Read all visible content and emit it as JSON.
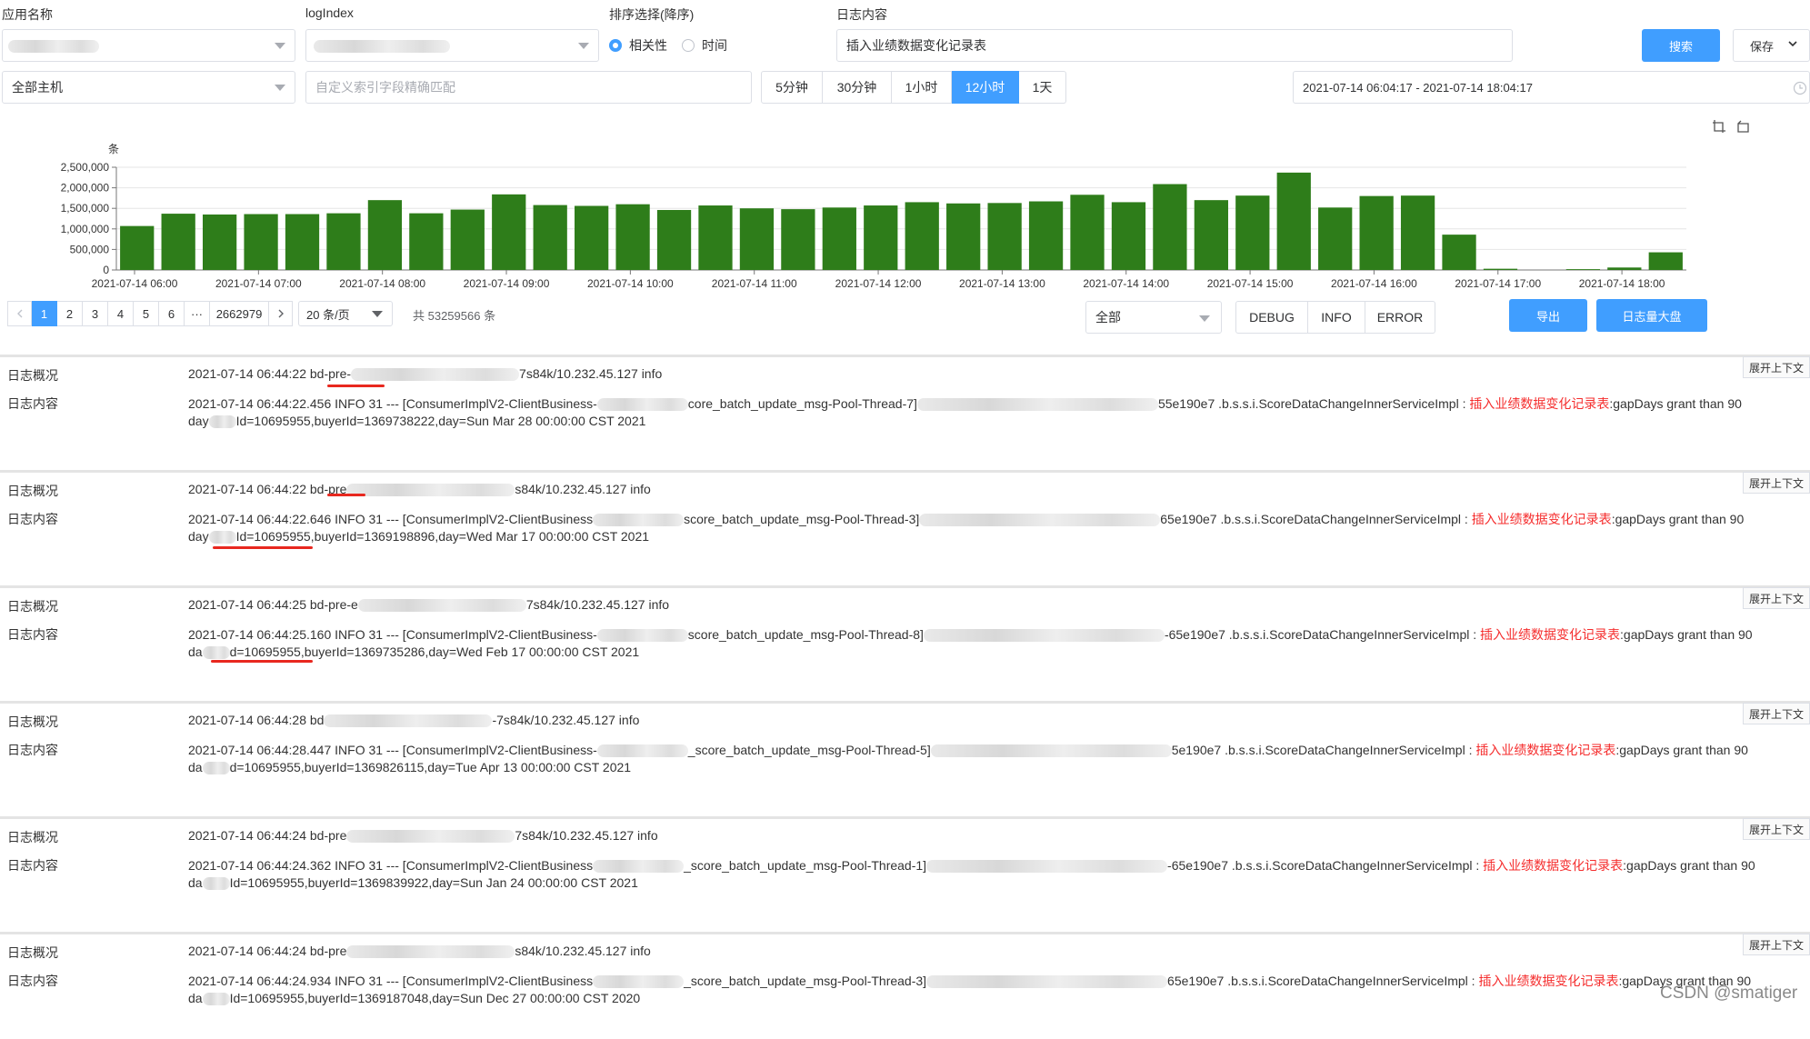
{
  "filters": {
    "app_label": "应用名称",
    "logindex_label": "logIndex",
    "sort_label": "排序选择(降序)",
    "sort_options": [
      "相关性",
      "时间"
    ],
    "sort_selected": "相关性",
    "content_label": "日志内容",
    "content_value": "插入业绩数据变化记录表",
    "search_button": "搜索",
    "save_button": "保存",
    "host_value": "全部主机",
    "custom_index_placeholder": "自定义索引字段精确匹配",
    "time_ranges": [
      "5分钟",
      "30分钟",
      "1小时",
      "12小时",
      "1天"
    ],
    "time_range_active": "12小时",
    "date_range": "2021-07-14 06:04:17 - 2021-07-14 18:04:17"
  },
  "chart_data": {
    "type": "bar",
    "ylabel": "条",
    "ylim": [
      0,
      2500000
    ],
    "yticks": [
      "2,500,000",
      "2,000,000",
      "1,500,000",
      "1,000,000",
      "500,000",
      "0"
    ],
    "xtick_labels": [
      "2021-07-14 06:00",
      "2021-07-14 07:00",
      "2021-07-14 08:00",
      "2021-07-14 09:00",
      "2021-07-14 10:00",
      "2021-07-14 11:00",
      "2021-07-14 12:00",
      "2021-07-14 13:00",
      "2021-07-14 14:00",
      "2021-07-14 15:00",
      "2021-07-14 16:00",
      "2021-07-14 17:00",
      "2021-07-14 18:00"
    ],
    "values": [
      1070000,
      1370000,
      1350000,
      1360000,
      1360000,
      1380000,
      1700000,
      1380000,
      1470000,
      1840000,
      1580000,
      1560000,
      1600000,
      1460000,
      1570000,
      1500000,
      1480000,
      1520000,
      1570000,
      1650000,
      1620000,
      1630000,
      1670000,
      1830000,
      1650000,
      2090000,
      1700000,
      1810000,
      2370000,
      1520000,
      1800000,
      1810000,
      860000,
      30000,
      0,
      20000,
      60000,
      430000
    ],
    "color": "#2e7d1a",
    "grid": true
  },
  "icons": [
    "zoom-icon",
    "restore-icon",
    "calendar-clock-icon",
    "chevron-down-icon"
  ],
  "pagination": {
    "pages": [
      "1",
      "2",
      "3",
      "4",
      "5",
      "6",
      "···",
      "2662979"
    ],
    "active": "1",
    "page_size": "20 条/页",
    "total": "共 53259566 条"
  },
  "level_filter": {
    "select_value": "全部",
    "levels": [
      "DEBUG",
      "INFO",
      "ERROR"
    ],
    "export_button": "导出",
    "dashboard_button": "日志量大盘"
  },
  "log_keys": {
    "overview": "日志概况",
    "content": "日志内容",
    "expand": "展开上下文"
  },
  "highlight_color": "#f52d2d",
  "logs": [
    {
      "overview_a": "2021-07-14 06:44:22 bd-pre-",
      "overview_b": "7s84k/10.232.45.127 info",
      "line1_a": "2021-07-14 06:44:22.456  INFO 31 --- [ConsumerImplV2-ClientBusiness-",
      "line1_b": "core_batch_update_msg-Pool-Thread-7]",
      "line1_c": "55e190e7 .b.s.s.i.ScoreDataChangeInnerServiceImpl : ",
      "highlight": "插入业绩数据变化记录表",
      "line1_d": ":gapDays grant than 90",
      "line2_a": "day",
      "line2_b": "Id=10695955,buyerId=1369738222,day=Sun Mar 28 00:00:00 CST 2021"
    },
    {
      "overview_a": "2021-07-14 06:44:22 bd-pre",
      "overview_b": "s84k/10.232.45.127 info",
      "line1_a": "2021-07-14 06:44:22.646  INFO 31 --- [ConsumerImplV2-ClientBusiness",
      "line1_b": "score_batch_update_msg-Pool-Thread-3]",
      "line1_c": "65e190e7 .b.s.s.i.ScoreDataChangeInnerServiceImpl : ",
      "highlight": "插入业绩数据变化记录表",
      "line1_d": ":gapDays grant than 90",
      "line2_a": "day",
      "line2_b": "Id=10695955,buyerId=1369198896,day=Wed Mar 17 00:00:00 CST 2021"
    },
    {
      "overview_a": "2021-07-14 06:44:25 bd-pre-e",
      "overview_b": "7s84k/10.232.45.127 info",
      "line1_a": "2021-07-14 06:44:25.160  INFO 31 --- [ConsumerImplV2-ClientBusiness-",
      "line1_b": "score_batch_update_msg-Pool-Thread-8]",
      "line1_c": "-65e190e7 .b.s.s.i.ScoreDataChangeInnerServiceImpl : ",
      "highlight": "插入业绩数据变化记录表",
      "line1_d": ":gapDays grant than 90",
      "line2_a": "da",
      "line2_b": "d=10695955,buyerId=1369735286,day=Wed Feb 17 00:00:00 CST 2021"
    },
    {
      "overview_a": "2021-07-14 06:44:28 bd",
      "overview_b": "-7s84k/10.232.45.127 info",
      "line1_a": "2021-07-14 06:44:28.447  INFO 31 --- [ConsumerImplV2-ClientBusiness-",
      "line1_b": "_score_batch_update_msg-Pool-Thread-5]",
      "line1_c": "5e190e7 .b.s.s.i.ScoreDataChangeInnerServiceImpl : ",
      "highlight": "插入业绩数据变化记录表",
      "line1_d": ":gapDays grant than 90",
      "line2_a": "da",
      "line2_b": "d=10695955,buyerId=1369826115,day=Tue Apr 13 00:00:00 CST 2021"
    },
    {
      "overview_a": "2021-07-14 06:44:24 bd-pre",
      "overview_b": "7s84k/10.232.45.127 info",
      "line1_a": "2021-07-14 06:44:24.362  INFO 31 --- [ConsumerImplV2-ClientBusiness",
      "line1_b": "_score_batch_update_msg-Pool-Thread-1]",
      "line1_c": "-65e190e7 .b.s.s.i.ScoreDataChangeInnerServiceImpl : ",
      "highlight": "插入业绩数据变化记录表",
      "line1_d": ":gapDays grant than 90",
      "line2_a": "da",
      "line2_b": "Id=10695955,buyerId=1369839922,day=Sun Jan 24 00:00:00 CST 2021"
    },
    {
      "overview_a": "2021-07-14 06:44:24 bd-pre",
      "overview_b": "s84k/10.232.45.127 info",
      "line1_a": "2021-07-14 06:44:24.934  INFO 31 --- [ConsumerImplV2-ClientBusiness",
      "line1_b": "_score_batch_update_msg-Pool-Thread-3]",
      "line1_c": "65e190e7 .b.s.s.i.ScoreDataChangeInnerServiceImpl : ",
      "highlight": "插入业绩数据变化记录表",
      "line1_d": ":gapDays grant than 90",
      "line2_a": "da",
      "line2_b": "Id=10695955,buyerId=1369187048,day=Sun Dec 27 00:00:00 CST 2020"
    }
  ],
  "watermark": "CSDN @smatiger"
}
